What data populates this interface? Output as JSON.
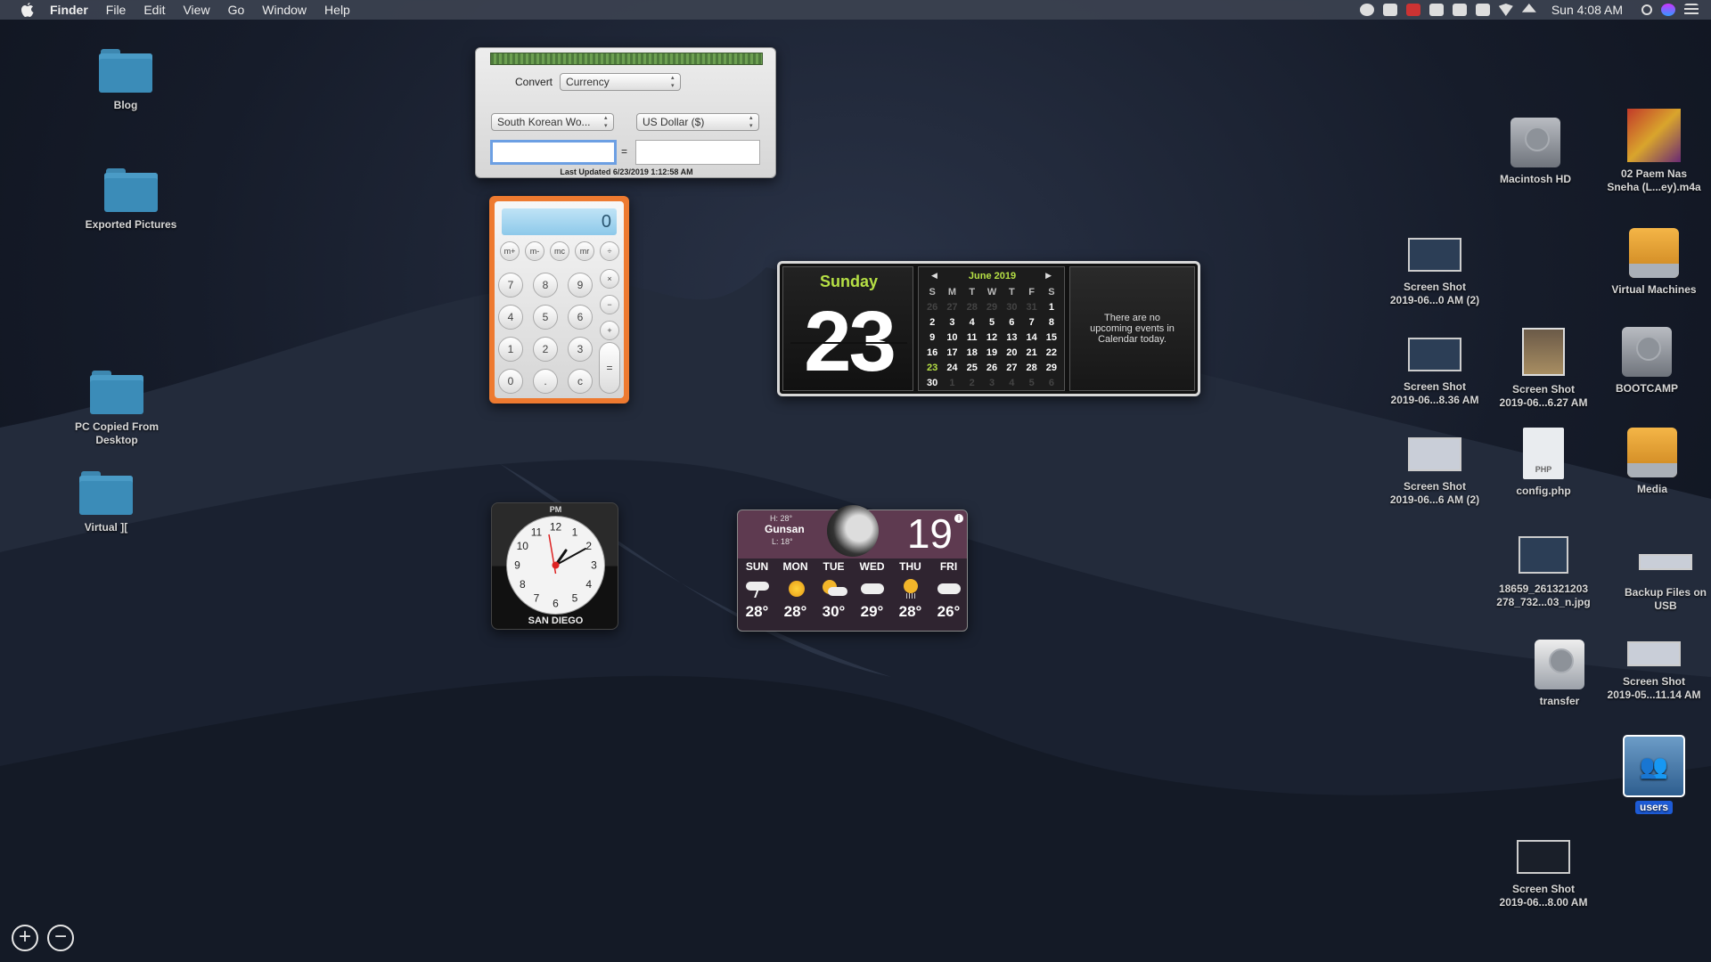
{
  "menubar": {
    "app": "Finder",
    "items": [
      "File",
      "Edit",
      "View",
      "Go",
      "Window",
      "Help"
    ],
    "clock": "Sun 4:08 AM"
  },
  "desktop": {
    "left_icons": [
      "Blog",
      "Exported Pictures",
      "PC Copied From\nDesktop",
      "Virtual ]["
    ],
    "right_icons": {
      "macintosh_hd": "Macintosh HD",
      "album": "02 Paem Nas\nSneha (L...ey).m4a",
      "shot1": "Screen Shot\n2019-06...0 AM (2)",
      "virtual_machines": "Virtual Machines",
      "shot2": "Screen Shot\n2019-06...8.36 AM",
      "shot3": "Screen Shot\n2019-06...6.27 AM",
      "bootcamp": "BOOTCAMP",
      "shot4": "Screen Shot\n2019-06...6 AM (2)",
      "config": "config.php",
      "config_badge": "PHP",
      "media": "Media",
      "jpg": "18659_261321203\n278_732...03_n.jpg",
      "backup": "Backup Files on\nUSB",
      "transfer": "transfer",
      "shot5": "Screen Shot\n2019-05...11.14 AM",
      "users": "users",
      "shot6": "Screen Shot\n2019-06...8.00 AM"
    }
  },
  "converter": {
    "convert_label": "Convert",
    "type": "Currency",
    "from": "South Korean Wo...",
    "to": "US Dollar ($)",
    "equals": "=",
    "input_value": "",
    "output_value": "",
    "last_updated": "Last Updated 6/23/2019 1:12:58 AM"
  },
  "calculator": {
    "display": "0",
    "memory_keys": [
      "m+",
      "m-",
      "mc",
      "mr"
    ],
    "ops": [
      "÷",
      "×",
      "−",
      "+",
      "="
    ],
    "rows": [
      [
        "7",
        "8",
        "9"
      ],
      [
        "4",
        "5",
        "6"
      ],
      [
        "1",
        "2",
        "3"
      ],
      [
        "0",
        ".",
        "c"
      ]
    ]
  },
  "clock_widget": {
    "ampm": "PM",
    "city": "SAN DIEGO",
    "hour_numbers": [
      "12",
      "1",
      "2",
      "3",
      "4",
      "5",
      "6",
      "7",
      "8",
      "9",
      "10",
      "11"
    ]
  },
  "calendar_widget": {
    "day_name": "Sunday",
    "day_number": "23",
    "month_title": "June 2019",
    "weekday_headers": [
      "S",
      "M",
      "T",
      "W",
      "T",
      "F",
      "S"
    ],
    "events_text": "There are no upcoming events in Calendar today.",
    "weeks": [
      [
        "26",
        "27",
        "28",
        "29",
        "30",
        "31",
        "1"
      ],
      [
        "2",
        "3",
        "4",
        "5",
        "6",
        "7",
        "8"
      ],
      [
        "9",
        "10",
        "11",
        "12",
        "13",
        "14",
        "15"
      ],
      [
        "16",
        "17",
        "18",
        "19",
        "20",
        "21",
        "22"
      ],
      [
        "23",
        "24",
        "25",
        "26",
        "27",
        "28",
        "29"
      ],
      [
        "30",
        "1",
        "2",
        "3",
        "4",
        "5",
        "6"
      ]
    ]
  },
  "weather_widget": {
    "city": "Gunsan",
    "high": "H: 28°",
    "low": "L: 18°",
    "current_temp": "19",
    "info": "i",
    "forecast": [
      {
        "day": "SUN",
        "temp": "28°",
        "icon": "storm-icon"
      },
      {
        "day": "MON",
        "temp": "28°",
        "icon": "sun-icon"
      },
      {
        "day": "TUE",
        "temp": "30°",
        "icon": "sun-cloud-icon"
      },
      {
        "day": "WED",
        "temp": "29°",
        "icon": "cloud-icon"
      },
      {
        "day": "THU",
        "temp": "28°",
        "icon": "sun-rain-icon"
      },
      {
        "day": "FRI",
        "temp": "26°",
        "icon": "cloud-icon"
      }
    ]
  },
  "dashboard": {
    "add": "+",
    "remove": "−"
  }
}
